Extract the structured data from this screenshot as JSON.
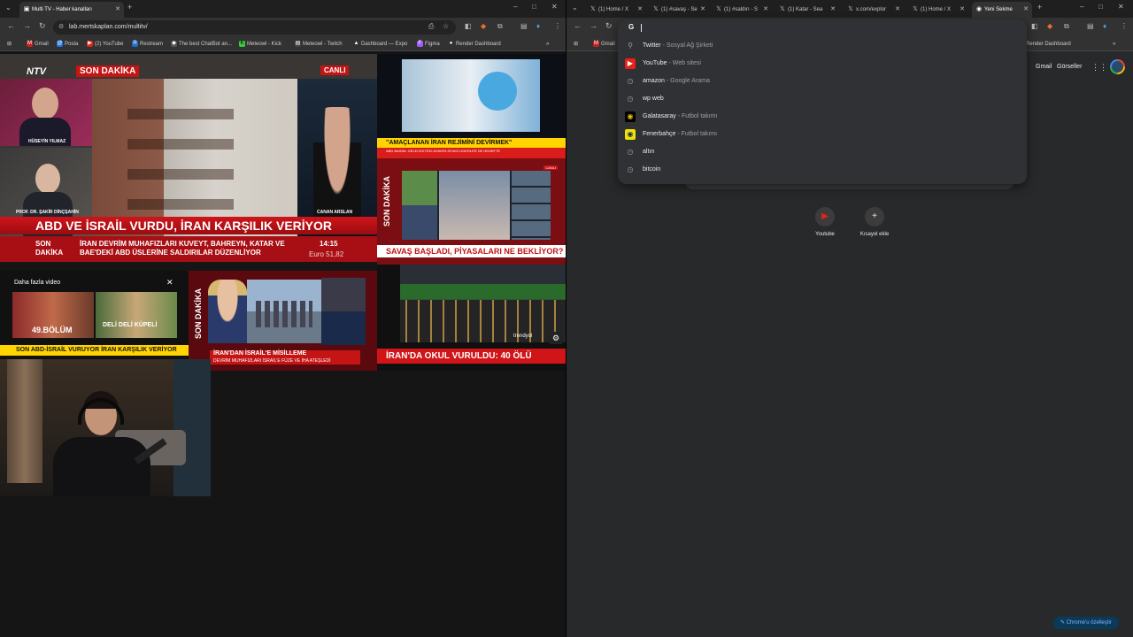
{
  "left": {
    "tab_title": "Multi TV - Haber kanalları",
    "url": "lab.mertskaplan.com/multitv/",
    "bookmarks": [
      "Gmail",
      "Posta",
      "(2) YouTube",
      "Restream",
      "The best ChatBot an...",
      "Meteowl - Kick",
      "Meteowl - Twitch",
      "Dashboard — Expo",
      "Figma",
      "Render Dashboard"
    ],
    "tv1": {
      "logo": "NTV",
      "son_dakika": "SON DAKİKA",
      "canli": "CANLI",
      "guest1": "HÜSEYİN YILMAZ",
      "guest2": "PROF. DR. ŞAKİR DİNÇŞAHİN",
      "anchor": "CANAN ARSLAN",
      "headline": "ABD VE İSRAİL VURDU, İRAN KARŞILIK VERİYOR",
      "ticker_label": "SON DAKİKA",
      "ticker_text": "İRAN DEVRİM MUHAFIZLARI KUVEYT, BAHREYN, KATAR VE BAE'DEKİ ABD ÜSLERİNE SALDIRILAR DÜZENLİYOR",
      "time": "14:15",
      "euro": "Euro  51,82"
    },
    "tv2": {
      "headline": "\"AMAÇLANAN İRAN REJİMİNİ DEVİRMEK\"",
      "sub": "ABD BASINI: GELECEKTEKİ ASKERİ-SİYASİ LİDERLER DE HEDEFTE"
    },
    "tv3": {
      "vertical": "SON DAKİKA",
      "canli": "CANLI",
      "headline": "SAVAŞ BAŞLADI, PİYASALARI NE BEKLİYOR?"
    },
    "tv4": {
      "brand": "trendyol",
      "headline": "İRAN'DA OKUL VURULDU: 40 ÖLÜ"
    },
    "tv5": {
      "title": "Daha fazla video",
      "episode": "49.BÖLÜM",
      "show": "DELİ DELİ KÜPELİ",
      "bottom": "ABD-İSRAİL VURUYOR İRAN KARŞILIK VERİYOR",
      "bottom_label": "SON"
    },
    "tv6": {
      "vertical": "SON DAKİKA",
      "headline": "İRAN'DAN İSRAİL'E MİSİLLEME",
      "sub": "DEVRİM MUHAFIZLARI İSRAİL'E FÜZE VE İHA ATEŞLEDİ"
    }
  },
  "right": {
    "tabs": [
      "(1) Home / X",
      "(1) #savaş - Se",
      "(1) #saldırı - S",
      "(1) Katar - Sea",
      "x.com/explor",
      "(1) Home / X",
      "Yeni Sekme"
    ],
    "bookmark_left": "Gmail",
    "bookmark_right": "Render Dashboard",
    "suggestions": [
      {
        "title": "Twitter",
        "sub": "Sosyal Ağ Şirketi",
        "icon": "search-icon"
      },
      {
        "title": "YouTube",
        "sub": "Web sitesi",
        "icon": "youtube-icon"
      },
      {
        "title": "amazon",
        "sub": "Google Arama",
        "icon": "history-icon"
      },
      {
        "title": "wp web",
        "sub": "",
        "icon": "history-icon"
      },
      {
        "title": "Galatasaray",
        "sub": "Futbol takımı",
        "icon": "galatasaray-icon"
      },
      {
        "title": "Fenerbahçe",
        "sub": "Futbol takımı",
        "icon": "fenerbahce-icon"
      },
      {
        "title": "altın",
        "sub": "",
        "icon": "history-icon"
      },
      {
        "title": "bitcoin",
        "sub": "",
        "icon": "history-icon"
      }
    ],
    "gmail": "Gmail",
    "images": "Görseller",
    "shortcuts": [
      {
        "label": "Youtube",
        "icon": "youtube-icon"
      },
      {
        "label": "Kısayol ekle",
        "icon": "plus-icon"
      }
    ],
    "customize": "Chrome'u özelleştir"
  }
}
